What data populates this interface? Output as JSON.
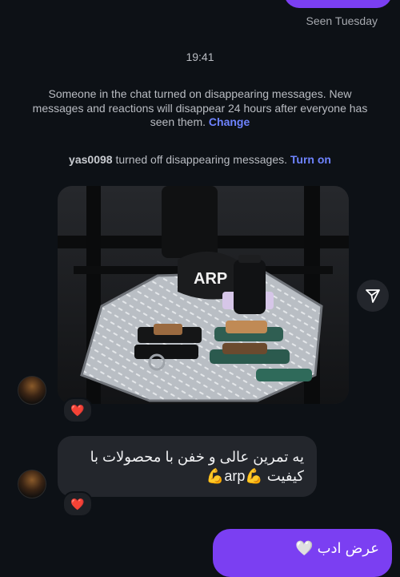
{
  "top_status": {
    "seen": "Seen Tuesday"
  },
  "timestamp": "19:41",
  "system_notice_1": {
    "text": "Someone in the chat turned on disappearing messages. New messages and reactions will disappear 24 hours after everyone has seen them.",
    "link": "Change"
  },
  "system_notice_2": {
    "user": "yas0098",
    "text": "turned off disappearing messages.",
    "link": "Turn on"
  },
  "photo_message": {
    "product_text": "ARP",
    "reaction": "❤️"
  },
  "text_message": {
    "text": "یه تمرین عالی و خفن با محصولات با کیفیت 💪arp💪",
    "reaction": "❤️"
  },
  "outgoing_message": {
    "text": "عرض ادب 🤍"
  },
  "colors": {
    "background": "#0d1116",
    "outgoing_bubble": "#7b3ff2",
    "incoming_bubble": "#23262c",
    "link": "#6e83ff"
  }
}
